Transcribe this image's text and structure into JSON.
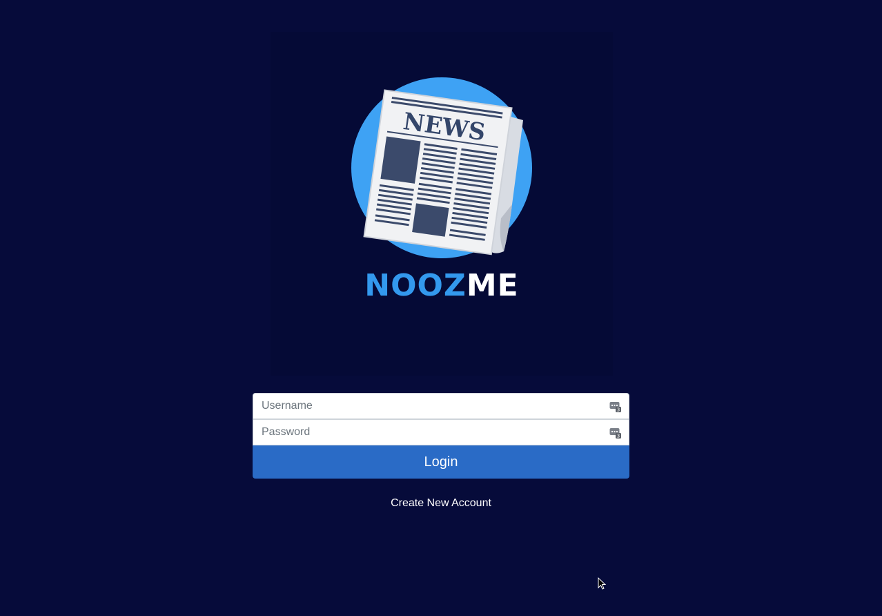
{
  "logo": {
    "newspaper_heading": "NEWS",
    "brand_part1": "NOOZ",
    "brand_part2": "ME"
  },
  "login_form": {
    "username_placeholder": "Username",
    "password_placeholder": "Password",
    "login_label": "Login",
    "username_icon": "password-manager-key-icon",
    "password_icon": "password-manager-key-icon"
  },
  "links": {
    "create_account": "Create New Account"
  },
  "colors": {
    "background": "#060b3a",
    "brand_blue": "#3399ee",
    "circle_blue": "#3ea2f4",
    "button_blue": "#2a6bc6"
  }
}
